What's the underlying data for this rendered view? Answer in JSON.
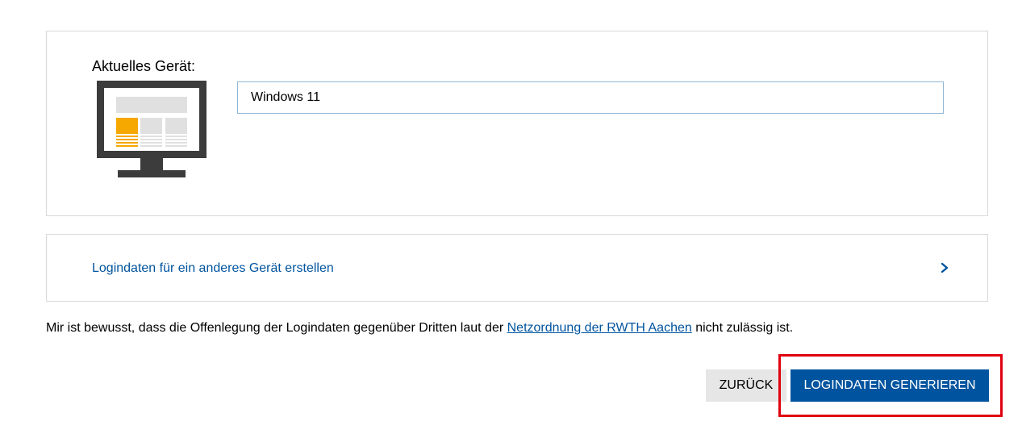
{
  "device_card": {
    "title": "Aktuelles Gerät:",
    "icon": "monitor-icon",
    "input_value": "Windows 11"
  },
  "other_device": {
    "label": "Logindaten für ein anderes Gerät erstellen",
    "icon": "chevron-right-icon"
  },
  "notice": {
    "prefix": "Mir ist bewusst, dass die Offenlegung der Logindaten gegenüber Dritten laut der ",
    "link_text": "Netzordnung der RWTH Aachen",
    "suffix": " nicht zulässig ist."
  },
  "buttons": {
    "back_label": "ZURÜCK",
    "generate_label": "LOGINDATEN GENERIEREN"
  },
  "colors": {
    "primary": "#00549f",
    "accent_orange": "#f6a800",
    "highlight": "#e0000f"
  }
}
